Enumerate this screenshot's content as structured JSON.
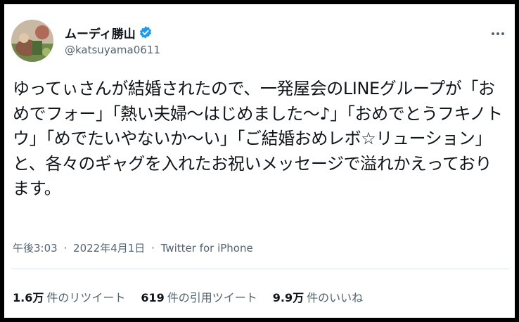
{
  "user": {
    "display_name": "ムーディ勝山",
    "handle": "@katsuyama0611"
  },
  "icons": {
    "verified": "verified-badge-icon",
    "more": "more-options-icon"
  },
  "tweet": {
    "text": "ゆってぃさんが結婚されたので、一発屋会のLINEグループが「おめでフォー」「熱い夫婦〜はじめました〜♪」「おめでとうフキノトウ」「めでたいやないか〜い」「ご結婚おめレボ☆リューション」と、各々のギャグを入れたお祝いメッセージで溢れかえっております。",
    "time": "午後3:03",
    "date": "2022年4月1日",
    "separator": "·",
    "source": "Twitter for iPhone"
  },
  "stats": {
    "retweets_count": "1.6万",
    "retweets_label": "件のリツイート",
    "quotes_count": "619",
    "quotes_label": "件の引用ツイート",
    "likes_count": "9.9万",
    "likes_label": "件のいいね"
  },
  "colors": {
    "verified_blue": "#1d9bf0",
    "text_primary": "#0f1419",
    "text_secondary": "#536471",
    "frame": "#000000"
  }
}
